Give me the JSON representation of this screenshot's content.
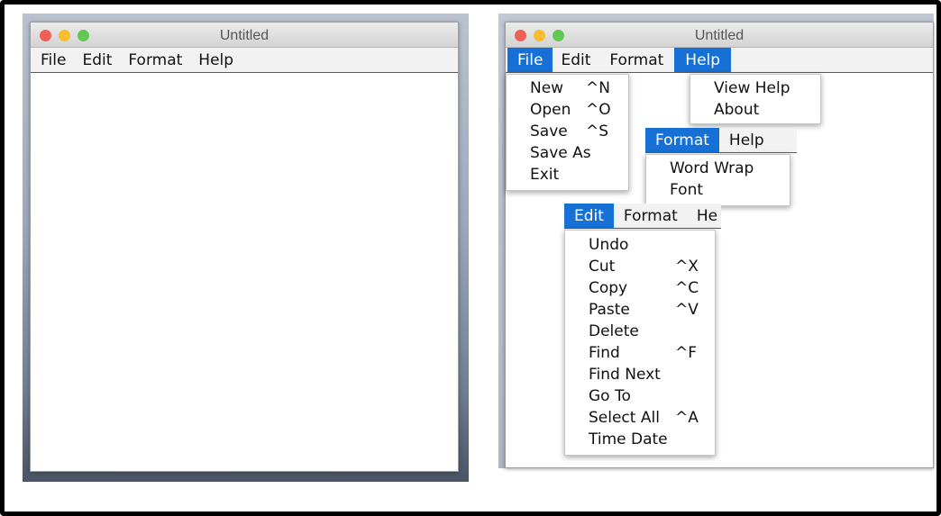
{
  "left_window": {
    "title": "Untitled",
    "menus": [
      "File",
      "Edit",
      "Format",
      "Help"
    ]
  },
  "right_window": {
    "title": "Untitled",
    "menus": [
      "File",
      "Edit",
      "Format",
      "Help"
    ],
    "active_menus": [
      "File",
      "Help"
    ]
  },
  "traffic_lights": {
    "close": "#ed5f57",
    "minimize": "#f6bd2f",
    "zoom": "#63c756"
  },
  "accent": "#1670d6",
  "file_menu": [
    {
      "label": "New",
      "shortcut": "^N"
    },
    {
      "label": "Open",
      "shortcut": "^O"
    },
    {
      "label": "Save",
      "shortcut": "^S"
    },
    {
      "label": "Save As",
      "shortcut": ""
    },
    {
      "label": "Exit",
      "shortcut": ""
    }
  ],
  "help_menu": [
    {
      "label": "View Help"
    },
    {
      "label": "About"
    }
  ],
  "format_strip": {
    "active": "Format",
    "next": "Help"
  },
  "format_menu": [
    {
      "label": "Word Wrap"
    },
    {
      "label": "Font"
    }
  ],
  "edit_strip": {
    "active": "Edit",
    "next": "Format",
    "partial": "He"
  },
  "edit_menu": [
    {
      "label": "Undo",
      "shortcut": ""
    },
    {
      "label": "Cut",
      "shortcut": "^X"
    },
    {
      "label": "Copy",
      "shortcut": "^C"
    },
    {
      "label": "Paste",
      "shortcut": "^V"
    },
    {
      "label": "Delete",
      "shortcut": ""
    },
    {
      "label": "Find",
      "shortcut": "^F"
    },
    {
      "label": "Find Next",
      "shortcut": ""
    },
    {
      "label": "Go To",
      "shortcut": ""
    },
    {
      "label": "Select All",
      "shortcut": "^A"
    },
    {
      "label": "Time Date",
      "shortcut": ""
    }
  ]
}
